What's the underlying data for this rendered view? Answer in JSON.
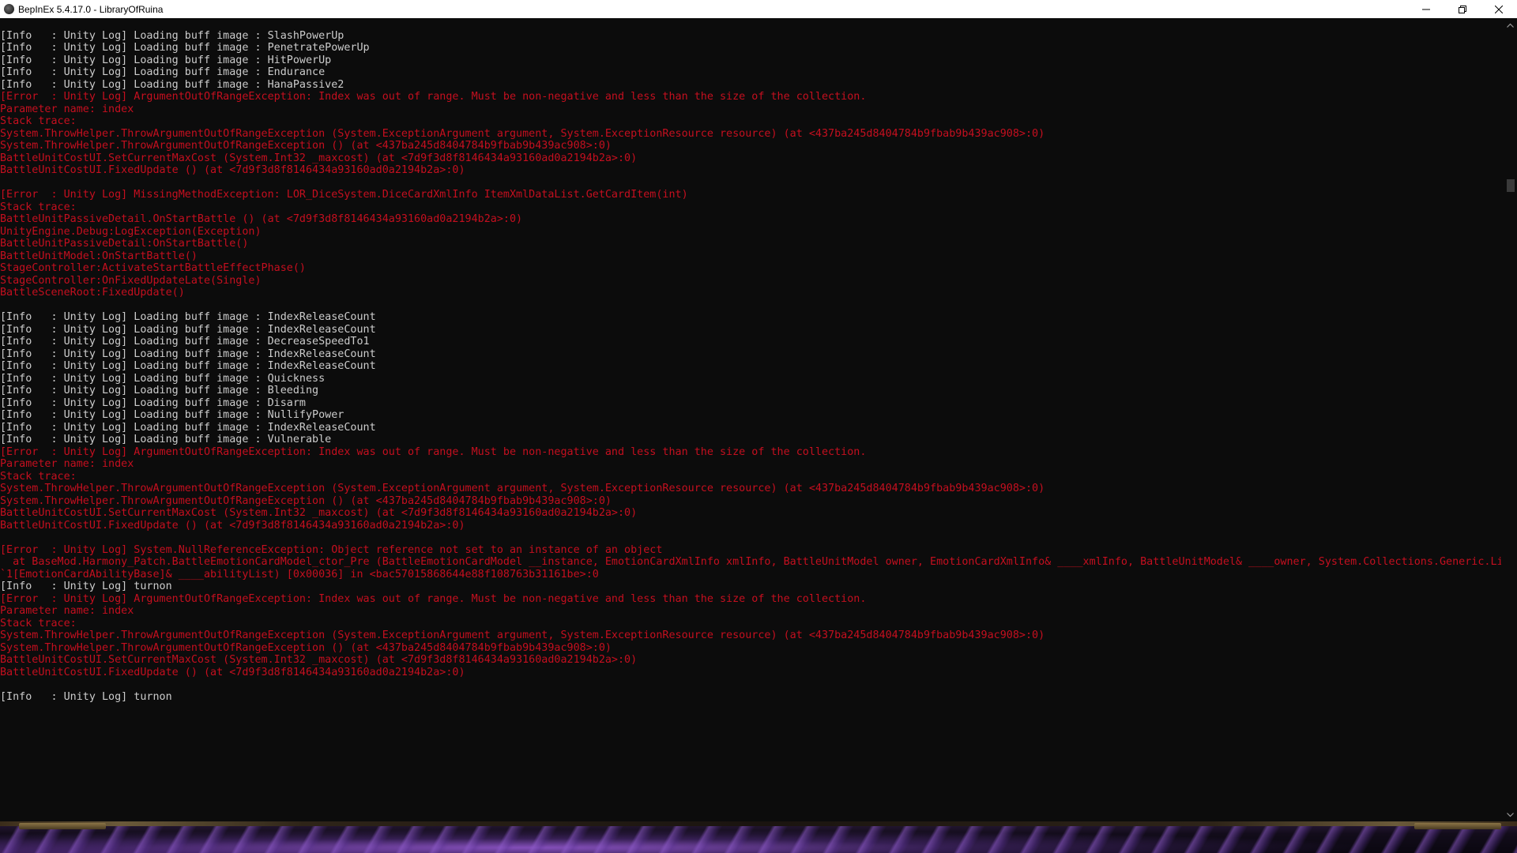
{
  "window": {
    "title": "BepInEx 5.4.17.0 - LibraryOfRuina",
    "app_icon": "bepinex-app-icon",
    "controls": {
      "minimize_icon": "minimize-icon",
      "maximize_icon": "restore-icon",
      "close_icon": "close-icon"
    }
  },
  "colors": {
    "background": "#0c0c0c",
    "info_text": "#cccccc",
    "error_text": "#c50f1f",
    "titlebar": "#ffffff"
  },
  "console": {
    "lines": [
      {
        "type": "info",
        "text": "[Info   : Unity Log] Loading buff image : SlashPowerUp"
      },
      {
        "type": "info",
        "text": "[Info   : Unity Log] Loading buff image : PenetratePowerUp"
      },
      {
        "type": "info",
        "text": "[Info   : Unity Log] Loading buff image : HitPowerUp"
      },
      {
        "type": "info",
        "text": "[Info   : Unity Log] Loading buff image : Endurance"
      },
      {
        "type": "info",
        "text": "[Info   : Unity Log] Loading buff image : HanaPassive2"
      },
      {
        "type": "error",
        "text": "[Error  : Unity Log] ArgumentOutOfRangeException: Index was out of range. Must be non-negative and less than the size of the collection."
      },
      {
        "type": "error",
        "text": "Parameter name: index"
      },
      {
        "type": "error",
        "text": "Stack trace:"
      },
      {
        "type": "error",
        "text": "System.ThrowHelper.ThrowArgumentOutOfRangeException (System.ExceptionArgument argument, System.ExceptionResource resource) (at <437ba245d8404784b9fbab9b439ac908>:0)"
      },
      {
        "type": "error",
        "text": "System.ThrowHelper.ThrowArgumentOutOfRangeException () (at <437ba245d8404784b9fbab9b439ac908>:0)"
      },
      {
        "type": "error",
        "text": "BattleUnitCostUI.SetCurrentMaxCost (System.Int32 _maxcost) (at <7d9f3d8f8146434a93160ad0a2194b2a>:0)"
      },
      {
        "type": "error",
        "text": "BattleUnitCostUI.FixedUpdate () (at <7d9f3d8f8146434a93160ad0a2194b2a>:0)"
      },
      {
        "type": "blank",
        "text": ""
      },
      {
        "type": "error",
        "text": "[Error  : Unity Log] MissingMethodException: LOR_DiceSystem.DiceCardXmlInfo ItemXmlDataList.GetCardItem(int)"
      },
      {
        "type": "error",
        "text": "Stack trace:"
      },
      {
        "type": "error",
        "text": "BattleUnitPassiveDetail.OnStartBattle () (at <7d9f3d8f8146434a93160ad0a2194b2a>:0)"
      },
      {
        "type": "error",
        "text": "UnityEngine.Debug:LogException(Exception)"
      },
      {
        "type": "error",
        "text": "BattleUnitPassiveDetail:OnStartBattle()"
      },
      {
        "type": "error",
        "text": "BattleUnitModel:OnStartBattle()"
      },
      {
        "type": "error",
        "text": "StageController:ActivateStartBattleEffectPhase()"
      },
      {
        "type": "error",
        "text": "StageController:OnFixedUpdateLate(Single)"
      },
      {
        "type": "error",
        "text": "BattleSceneRoot:FixedUpdate()"
      },
      {
        "type": "blank",
        "text": ""
      },
      {
        "type": "info",
        "text": "[Info   : Unity Log] Loading buff image : IndexReleaseCount"
      },
      {
        "type": "info",
        "text": "[Info   : Unity Log] Loading buff image : IndexReleaseCount"
      },
      {
        "type": "info",
        "text": "[Info   : Unity Log] Loading buff image : DecreaseSpeedTo1"
      },
      {
        "type": "info",
        "text": "[Info   : Unity Log] Loading buff image : IndexReleaseCount"
      },
      {
        "type": "info",
        "text": "[Info   : Unity Log] Loading buff image : IndexReleaseCount"
      },
      {
        "type": "info",
        "text": "[Info   : Unity Log] Loading buff image : Quickness"
      },
      {
        "type": "info",
        "text": "[Info   : Unity Log] Loading buff image : Bleeding"
      },
      {
        "type": "info",
        "text": "[Info   : Unity Log] Loading buff image : Disarm"
      },
      {
        "type": "info",
        "text": "[Info   : Unity Log] Loading buff image : NullifyPower"
      },
      {
        "type": "info",
        "text": "[Info   : Unity Log] Loading buff image : IndexReleaseCount"
      },
      {
        "type": "info",
        "text": "[Info   : Unity Log] Loading buff image : Vulnerable"
      },
      {
        "type": "error",
        "text": "[Error  : Unity Log] ArgumentOutOfRangeException: Index was out of range. Must be non-negative and less than the size of the collection."
      },
      {
        "type": "error",
        "text": "Parameter name: index"
      },
      {
        "type": "error",
        "text": "Stack trace:"
      },
      {
        "type": "error",
        "text": "System.ThrowHelper.ThrowArgumentOutOfRangeException (System.ExceptionArgument argument, System.ExceptionResource resource) (at <437ba245d8404784b9fbab9b439ac908>:0)"
      },
      {
        "type": "error",
        "text": "System.ThrowHelper.ThrowArgumentOutOfRangeException () (at <437ba245d8404784b9fbab9b439ac908>:0)"
      },
      {
        "type": "error",
        "text": "BattleUnitCostUI.SetCurrentMaxCost (System.Int32 _maxcost) (at <7d9f3d8f8146434a93160ad0a2194b2a>:0)"
      },
      {
        "type": "error",
        "text": "BattleUnitCostUI.FixedUpdate () (at <7d9f3d8f8146434a93160ad0a2194b2a>:0)"
      },
      {
        "type": "blank",
        "text": ""
      },
      {
        "type": "error",
        "text": "[Error  : Unity Log] System.NullReferenceException: Object reference not set to an instance of an object"
      },
      {
        "type": "error",
        "text": "  at BaseMod.Harmony_Patch.BattleEmotionCardModel_ctor_Pre (BattleEmotionCardModel __instance, EmotionCardXmlInfo xmlInfo, BattleUnitModel owner, EmotionCardXmlInfo& ____xmlInfo, BattleUnitModel& ____owner, System.Collections.Generic.Lis"
      },
      {
        "type": "error",
        "text": "`1[EmotionCardAbilityBase]& ____abilityList) [0x00036] in <bac57015868644e88f108763b31161be>:0"
      },
      {
        "type": "info",
        "text": "[Info   : Unity Log] turnon"
      },
      {
        "type": "error",
        "text": "[Error  : Unity Log] ArgumentOutOfRangeException: Index was out of range. Must be non-negative and less than the size of the collection."
      },
      {
        "type": "error",
        "text": "Parameter name: index"
      },
      {
        "type": "error",
        "text": "Stack trace:"
      },
      {
        "type": "error",
        "text": "System.ThrowHelper.ThrowArgumentOutOfRangeException (System.ExceptionArgument argument, System.ExceptionResource resource) (at <437ba245d8404784b9fbab9b439ac908>:0)"
      },
      {
        "type": "error",
        "text": "System.ThrowHelper.ThrowArgumentOutOfRangeException () (at <437ba245d8404784b9fbab9b439ac908>:0)"
      },
      {
        "type": "error",
        "text": "BattleUnitCostUI.SetCurrentMaxCost (System.Int32 _maxcost) (at <7d9f3d8f8146434a93160ad0a2194b2a>:0)"
      },
      {
        "type": "error",
        "text": "BattleUnitCostUI.FixedUpdate () (at <7d9f3d8f8146434a93160ad0a2194b2a>:0)"
      },
      {
        "type": "blank",
        "text": ""
      },
      {
        "type": "info",
        "text": "[Info   : Unity Log] turnon"
      }
    ]
  }
}
